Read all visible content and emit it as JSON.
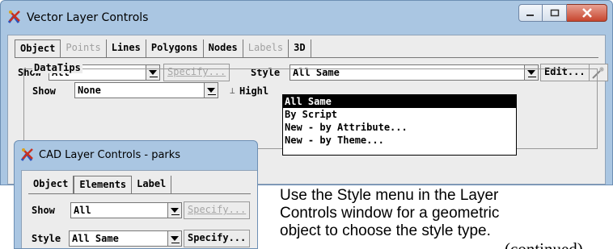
{
  "main_window": {
    "title": "Vector Layer Controls",
    "tabs": [
      {
        "label": "Object",
        "state": "active"
      },
      {
        "label": "Points",
        "state": "disabled"
      },
      {
        "label": "Lines",
        "state": "normal"
      },
      {
        "label": "Polygons",
        "state": "normal"
      },
      {
        "label": "Nodes",
        "state": "normal"
      },
      {
        "label": "Labels",
        "state": "disabled"
      },
      {
        "label": "3D",
        "state": "normal"
      }
    ],
    "show_label": "Show",
    "show_value": "All",
    "specify_label": "Specify...",
    "style_label": "Style",
    "style_value": "All Same",
    "edit_label": "Edit...",
    "style_options": [
      "All Same",
      "By Script",
      "New - by Attribute...",
      "New - by Theme..."
    ],
    "selected_style_option": "All Same",
    "datatips": {
      "title": "DataTips",
      "show_label": "Show",
      "show_value": "None",
      "highlight_label": "Highl"
    }
  },
  "cad_window": {
    "title": "CAD Layer Controls - parks",
    "tabs": [
      {
        "label": "Object",
        "state": "normal"
      },
      {
        "label": "Elements",
        "state": "active"
      },
      {
        "label": "Label",
        "state": "normal"
      }
    ],
    "show_label": "Show",
    "show_value": "All",
    "specify_disabled_label": "Specify...",
    "style_label": "Style",
    "style_value": "All Same",
    "specify_label": "Specify..."
  },
  "caption": {
    "line1": "Use the Style menu in the Layer",
    "line2": "Controls window for a geometric",
    "line3": "object to choose the style type.",
    "continued": "(continued)"
  },
  "colors": {
    "frame": "#aac6e2",
    "client": "#ececec",
    "close_button": "#c7462f",
    "selection": "#000000"
  },
  "icons": [
    "app-icon",
    "minimize-icon",
    "maximize-icon",
    "close-icon",
    "dropdown-arrow-icon",
    "wand-icon"
  ]
}
